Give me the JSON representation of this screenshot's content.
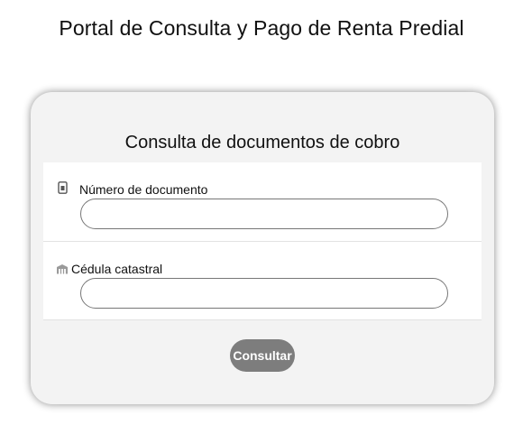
{
  "header": {
    "title": "Portal de Consulta y Pago de Renta Predial"
  },
  "card": {
    "title": "Consulta de documentos de cobro",
    "fields": [
      {
        "icon": "mobile-document-icon",
        "label": "Número de documento",
        "value": "",
        "placeholder": ""
      },
      {
        "icon": "building-icon",
        "label": "Cédula catastral",
        "value": "",
        "placeholder": ""
      }
    ],
    "submit_label": "Consultar"
  },
  "colors": {
    "card_background": "#f3f3f3",
    "button_background": "#7d7d7d",
    "button_text": "#ffffff",
    "input_border": "#777777"
  }
}
